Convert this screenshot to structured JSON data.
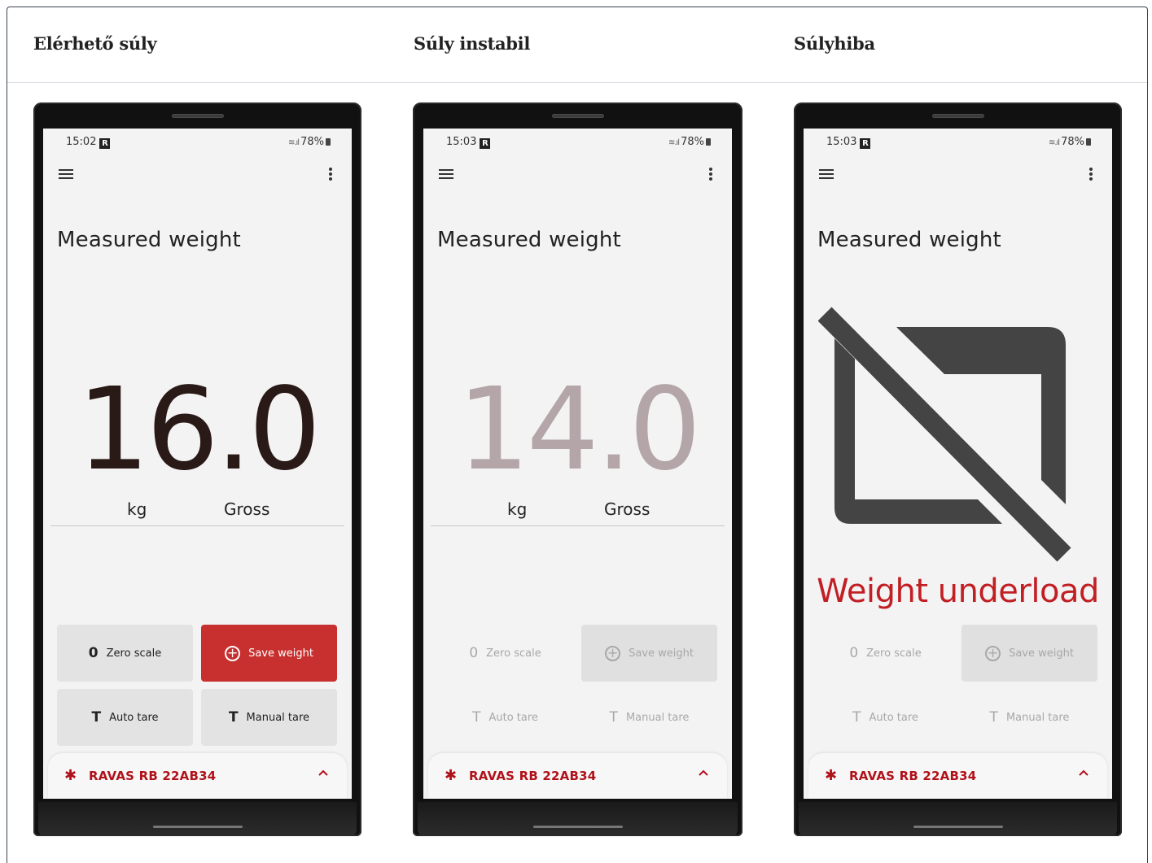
{
  "columns": [
    {
      "heading": "Elérhető súly",
      "phone": {
        "status_time": "15:02",
        "status_logo": "R",
        "status_battery": "78%",
        "title": "Measured weight",
        "weight": "16.0",
        "weight_state": "stable",
        "unit": "kg",
        "mode": "Gross",
        "buttons": {
          "zero_glyph": "0",
          "zero_label": "Zero scale",
          "save_glyph": "+",
          "save_label": "Save weight",
          "auto_glyph": "T",
          "auto_label": "Auto tare",
          "manual_glyph": "T",
          "manual_label": "Manual tare"
        },
        "bluetooth_glyph": "✱",
        "device_name": "RAVAS RB 22AB34"
      }
    },
    {
      "heading": "Súly instabil",
      "phone": {
        "status_time": "15:03",
        "status_logo": "R",
        "status_battery": "78%",
        "title": "Measured weight",
        "weight": "14.0",
        "weight_state": "unstable",
        "unit": "kg",
        "mode": "Gross",
        "buttons": {
          "zero_glyph": "0",
          "zero_label": "Zero scale",
          "save_glyph": "+",
          "save_label": "Save weight",
          "auto_glyph": "T",
          "auto_label": "Auto tare",
          "manual_glyph": "T",
          "manual_label": "Manual tare"
        },
        "bluetooth_glyph": "✱",
        "device_name": "RAVAS RB 22AB34"
      }
    },
    {
      "heading": "Súlyhiba",
      "phone": {
        "status_time": "15:03",
        "status_logo": "R",
        "status_battery": "78%",
        "title": "Measured weight",
        "error_message": "Weight underload",
        "error_icon": "weight-unavailable-icon",
        "buttons": {
          "zero_glyph": "0",
          "zero_label": "Zero scale",
          "save_glyph": "+",
          "save_label": "Save weight",
          "auto_glyph": "T",
          "auto_label": "Auto tare",
          "manual_glyph": "T",
          "manual_label": "Manual tare"
        },
        "bluetooth_glyph": "✱",
        "device_name": "RAVAS RB 22AB34"
      }
    }
  ],
  "colors": {
    "accent_red": "#c7302e",
    "error_red": "#c11f24",
    "bluetooth_red": "#b0121a",
    "weight_stable": "#2a1a17",
    "weight_unstable": "#b3a5a8",
    "icon_gray": "#444444"
  }
}
